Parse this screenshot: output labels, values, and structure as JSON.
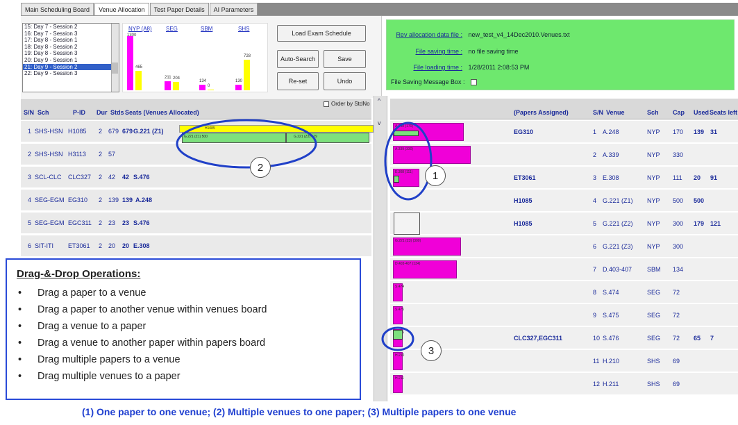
{
  "tabs": [
    "Main Scheduling Board",
    "Venue Allocation",
    "Test Paper Details",
    "AI Parameters"
  ],
  "sessions": [
    "15: Day 7 - Session 2",
    "16: Day 7 - Session 3",
    "17: Day 8 - Session 1",
    "18: Day 8 - Session 2",
    "19: Day 8 - Session 3",
    "20: Day 9 - Session 1",
    "21: Day 9 - Session 2",
    "22: Day 9 - Session 3"
  ],
  "selected_session": "21: Day 9 - Session 2",
  "chart_data": {
    "type": "bar",
    "categories": [
      "NYP (A8)",
      "SEG",
      "SBM",
      "SHS"
    ],
    "series": [
      {
        "color": "#ff00ff",
        "values": [
          1300,
          211,
          134,
          130
        ]
      },
      {
        "color": "#ffff00",
        "values": [
          465,
          204,
          0,
          728
        ]
      }
    ],
    "bar_labels": [
      "1300",
      "465",
      "211",
      "204",
      "134",
      "0",
      "130",
      "728"
    ]
  },
  "buttons": {
    "load": "Load Exam Schedule",
    "auto_search": "Auto-Search",
    "save": "Save",
    "reset": "Re-set",
    "undo": "Undo"
  },
  "info": {
    "rev_key": "Rev allocation data file :",
    "rev_val": "new_test_v4_14Dec2010.Venues.txt",
    "saving_key": "File saving time :",
    "saving_val": "no file saving time",
    "loading_key": "File loading time :",
    "loading_val": "1/28/2011 2:08:53 PM",
    "msgbox_key": "File Saving Message Box :"
  },
  "left_header": {
    "sn": "S/N",
    "sch": "Sch",
    "pid": "P-ID",
    "dur": "Dur",
    "stds": "Stds",
    "seats": "Seats (Venues Allocated)",
    "order": "Order by StdNo"
  },
  "papers": [
    {
      "sn": "1",
      "sch": "SHS-HSN",
      "pid": "H1085",
      "dur": "2",
      "stds": "679",
      "seats": "679",
      "venues": "G.221 (Z1)"
    },
    {
      "sn": "2",
      "sch": "SHS-HSN",
      "pid": "H3113",
      "dur": "2",
      "stds": "57",
      "seats": "",
      "venues": ""
    },
    {
      "sn": "3",
      "sch": "SCL-CLC",
      "pid": "CLC327",
      "dur": "2",
      "stds": "42",
      "seats": "42",
      "venues": "S.476"
    },
    {
      "sn": "4",
      "sch": "SEG-EGM",
      "pid": "EG310",
      "dur": "2",
      "stds": "139",
      "seats": "139",
      "venues": "A.248"
    },
    {
      "sn": "5",
      "sch": "SEG-EGM",
      "pid": "EGC311",
      "dur": "2",
      "stds": "23",
      "seats": "23",
      "venues": "S.476"
    },
    {
      "sn": "6",
      "sch": "SIT-ITI",
      "pid": "ET3061",
      "dur": "2",
      "stds": "20",
      "seats": "20",
      "venues": "E.308"
    }
  ],
  "paper_boxes": {
    "g1": "G.221 (Z1) 500",
    "g2": "G.221 (Z2) 179",
    "h1085": "H1085",
    "z3": "G.221 (Z3)"
  },
  "right_header": {
    "papers": "(Papers Assigned)",
    "sn": "S/N",
    "venue": "Venue",
    "sch": "Sch",
    "cap": "Cap",
    "used": "Used",
    "left": "Seats left"
  },
  "venues": [
    {
      "sn": "1",
      "venue": "A.248",
      "sch": "NYP",
      "cap": "170",
      "used": "139",
      "left": "31",
      "papers": "EG310",
      "box": "A.248 (170)"
    },
    {
      "sn": "2",
      "venue": "A.339",
      "sch": "NYP",
      "cap": "330",
      "used": "",
      "left": "",
      "papers": "",
      "box": "A.339 (330)"
    },
    {
      "sn": "3",
      "venue": "E.308",
      "sch": "NYP",
      "cap": "111",
      "used": "20",
      "left": "91",
      "papers": "ET3061",
      "box": "E.308 (111)"
    },
    {
      "sn": "4",
      "venue": "G.221 (Z1)",
      "sch": "NYP",
      "cap": "500",
      "used": "500",
      "left": "",
      "papers": "H1085",
      "box": ""
    },
    {
      "sn": "5",
      "venue": "G.221 (Z2)",
      "sch": "NYP",
      "cap": "300",
      "used": "179",
      "left": "121",
      "papers": "H1085",
      "box": ""
    },
    {
      "sn": "6",
      "venue": "G.221 (Z3)",
      "sch": "NYP",
      "cap": "300",
      "used": "",
      "left": "",
      "papers": "",
      "box": "G.221 (Z3) (300)"
    },
    {
      "sn": "7",
      "venue": "D.403-407",
      "sch": "SBM",
      "cap": "134",
      "used": "",
      "left": "",
      "papers": "",
      "box": "D.403-407 (134)"
    },
    {
      "sn": "8",
      "venue": "S.474",
      "sch": "SEG",
      "cap": "72",
      "used": "",
      "left": "",
      "papers": "",
      "box": "S.474"
    },
    {
      "sn": "9",
      "venue": "S.475",
      "sch": "SEG",
      "cap": "72",
      "used": "",
      "left": "",
      "papers": "",
      "box": "S.475"
    },
    {
      "sn": "10",
      "venue": "S.476",
      "sch": "SEG",
      "cap": "72",
      "used": "65",
      "left": "7",
      "papers": "CLC327,EGC311",
      "box": "S.476"
    },
    {
      "sn": "11",
      "venue": "H.210",
      "sch": "SHS",
      "cap": "69",
      "used": "",
      "left": "",
      "papers": "",
      "box": "H.210"
    },
    {
      "sn": "12",
      "venue": "H.211",
      "sch": "SHS",
      "cap": "69",
      "used": "",
      "left": "",
      "papers": "",
      "box": "H.211"
    }
  ],
  "callout": {
    "title": "Drag-&-Drop Operations:",
    "items": [
      "Drag a paper to a venue",
      "Drag a paper to another venue within venues board",
      "Drag a venue to a paper",
      "Drag a venue to another paper within papers board",
      "Drag multiple papers to a venue",
      "Drag multiple venues to a paper"
    ]
  },
  "markers": {
    "m1": "1",
    "m2": "2",
    "m3": "3"
  },
  "footer": "(1) One paper to one venue;  (2) Multiple venues to one paper; (3) Multiple papers to one venue"
}
